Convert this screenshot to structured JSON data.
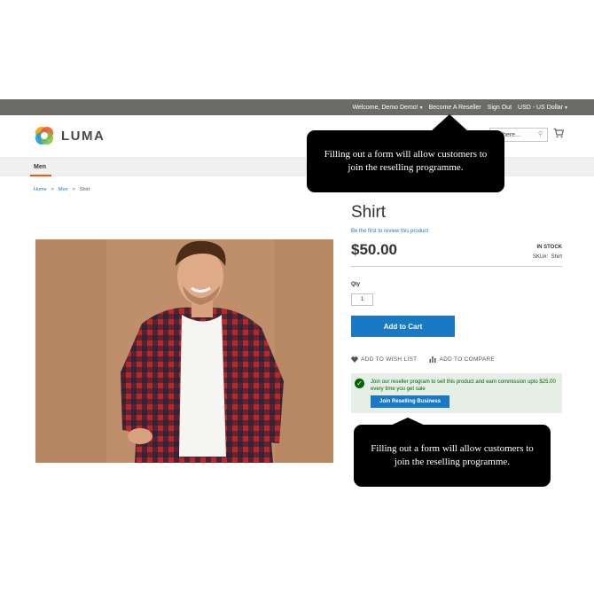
{
  "topbar": {
    "welcome": "Welcome, Demo Demo!",
    "reseller": "Become A Reseller",
    "sign_out": "Sign Out",
    "currency": "USD - US Dollar"
  },
  "header": {
    "logo_text": "LUMA",
    "search_value": "here..."
  },
  "nav": {
    "items": [
      {
        "label": "Men"
      }
    ]
  },
  "breadcrumb": {
    "items": [
      "Home",
      "Men",
      "Shirt"
    ],
    "separator": ">"
  },
  "product": {
    "title": "Shirt",
    "review_link": "Be the first to review this product",
    "price": "$50.00",
    "stock": "IN STOCK",
    "sku_label": "SKU#:",
    "sku_value": "Shirt",
    "qty_label": "Qty",
    "qty_value": "1",
    "add_to_cart": "Add to Cart",
    "wishlist": "ADD TO WISH LIST",
    "compare": "ADD TO COMPARE"
  },
  "reseller_box": {
    "message": "Join our reseller program to sell this product and earn commission upto $25.00 every time you get sale",
    "button": "Join Reselling Business"
  },
  "callouts": [
    {
      "text": "Filling out a form will allow customers to join the reselling programme."
    },
    {
      "text": "Filling out a form will allow customers to join the reselling programme."
    }
  ],
  "colors": {
    "topbar": "#6b6b68",
    "primary_blue": "#1979c3",
    "accent_orange": "#ff5501",
    "success_green": "#006400",
    "success_bg": "#e5efe5",
    "callout_bg": "#000000"
  },
  "icons": [
    "luma-logo-icon",
    "search-icon",
    "cart-icon",
    "heart-icon",
    "compare-icon",
    "check-icon",
    "chevron-down-icon"
  ]
}
